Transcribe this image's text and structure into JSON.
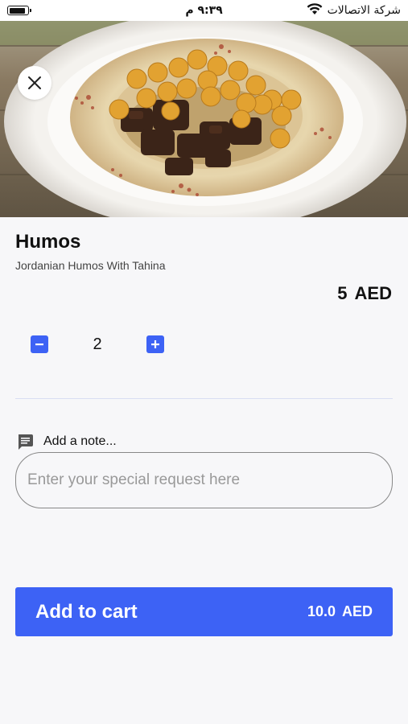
{
  "status_bar": {
    "time": "٩:٣٩ م",
    "carrier": "شركة الاتصالات",
    "battery_level": 0.95,
    "icons": [
      "battery-icon",
      "wifi-icon"
    ]
  },
  "hero": {
    "image_icon": "food-photo-icon",
    "close_icon": "close-icon"
  },
  "item": {
    "title": "Humos",
    "subtitle": "Jordanian Humos With Tahina",
    "price_amount": "5",
    "price_currency": "AED"
  },
  "quantity": {
    "value": "2",
    "decrement_icon": "minus-icon",
    "increment_icon": "plus-icon"
  },
  "note": {
    "label": "Add a note...",
    "icon": "message-icon",
    "placeholder": "Enter your special request here",
    "value": ""
  },
  "cart_button": {
    "label": "Add to cart",
    "total_amount": "10.0",
    "total_currency": "AED"
  },
  "colors": {
    "accent": "#3d62f5",
    "background": "#f7f7f9",
    "divider": "#d9def3"
  }
}
